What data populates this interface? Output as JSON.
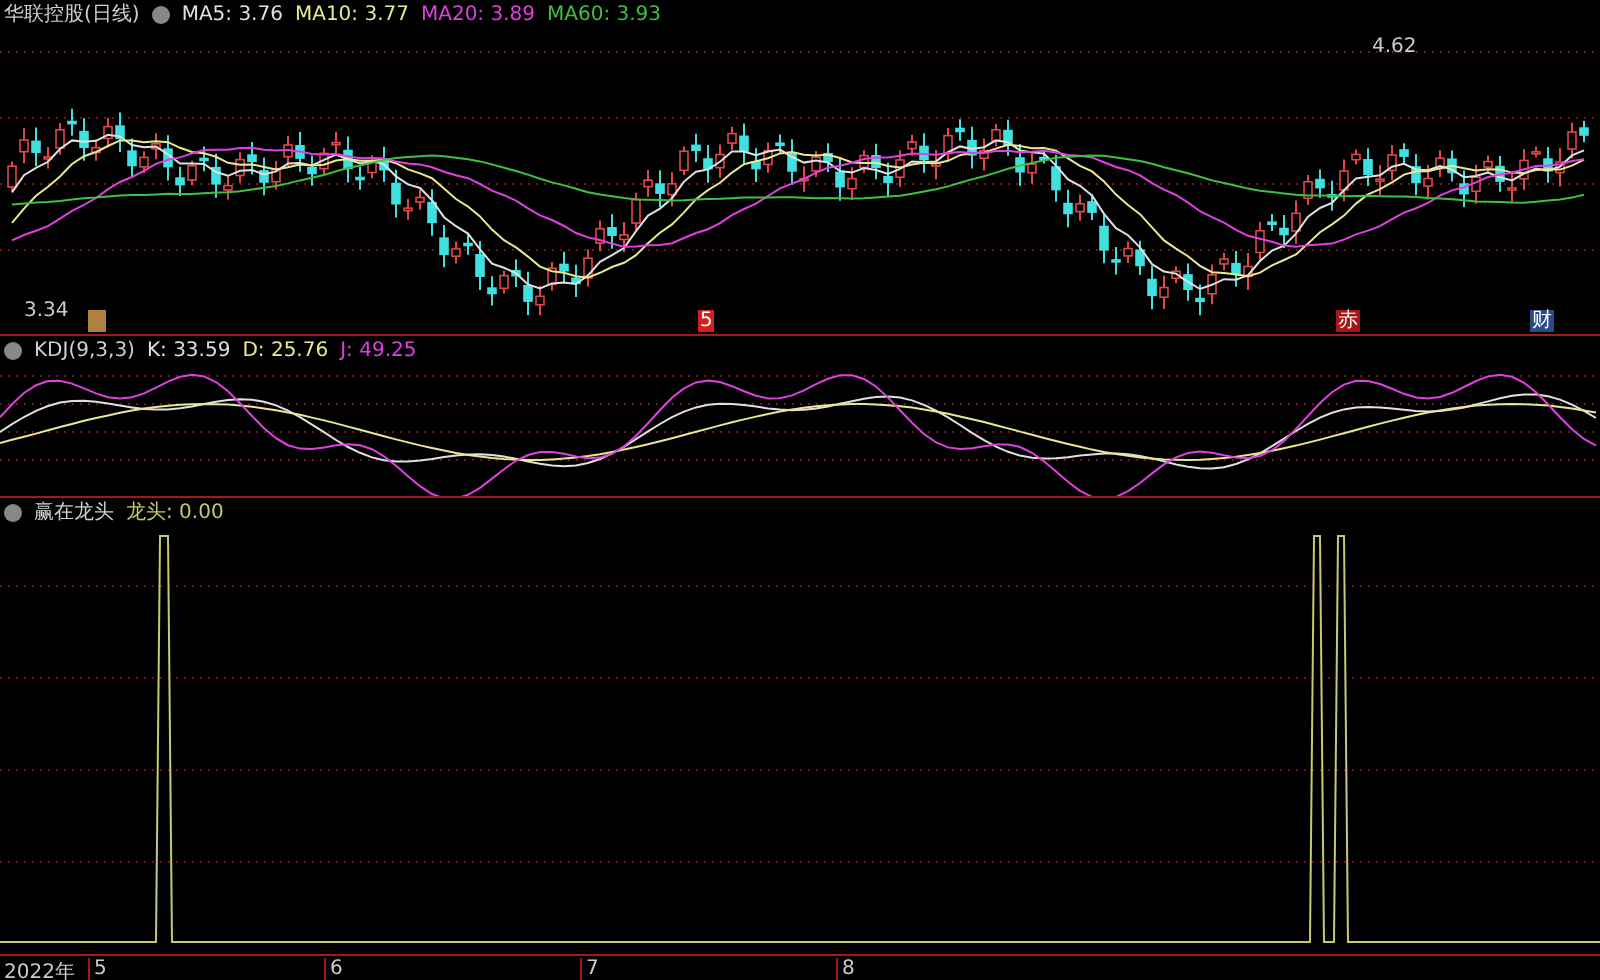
{
  "stock_title": "华联控股(日线)",
  "ma_legend": [
    {
      "label": "MA5: 3.76",
      "color": "#e0e0e0"
    },
    {
      "label": "MA10: 3.77",
      "color": "#e8e890"
    },
    {
      "label": "MA20: 3.89",
      "color": "#e040e0"
    },
    {
      "label": "MA60: 3.93",
      "color": "#40c040"
    }
  ],
  "price_high_label": "4.62",
  "price_low_label": "3.34",
  "event_tags": [
    {
      "text": "5",
      "color": "#d02020"
    },
    {
      "text": "赤",
      "color": "#a01818"
    },
    {
      "text": "财",
      "color": "#2a4a8a"
    }
  ],
  "kdj": {
    "title": "KDJ(9,3,3)",
    "values": [
      {
        "label": "K: 33.59",
        "color": "#e0e0e0"
      },
      {
        "label": "D: 25.76",
        "color": "#e8e890"
      },
      {
        "label": "J: 49.25",
        "color": "#e040e0"
      }
    ]
  },
  "signal": {
    "title": "赢在龙头",
    "legend": "龙头: 0.00"
  },
  "time_axis": {
    "year": "2022年",
    "months": [
      "5",
      "6",
      "7",
      "8"
    ]
  }
}
